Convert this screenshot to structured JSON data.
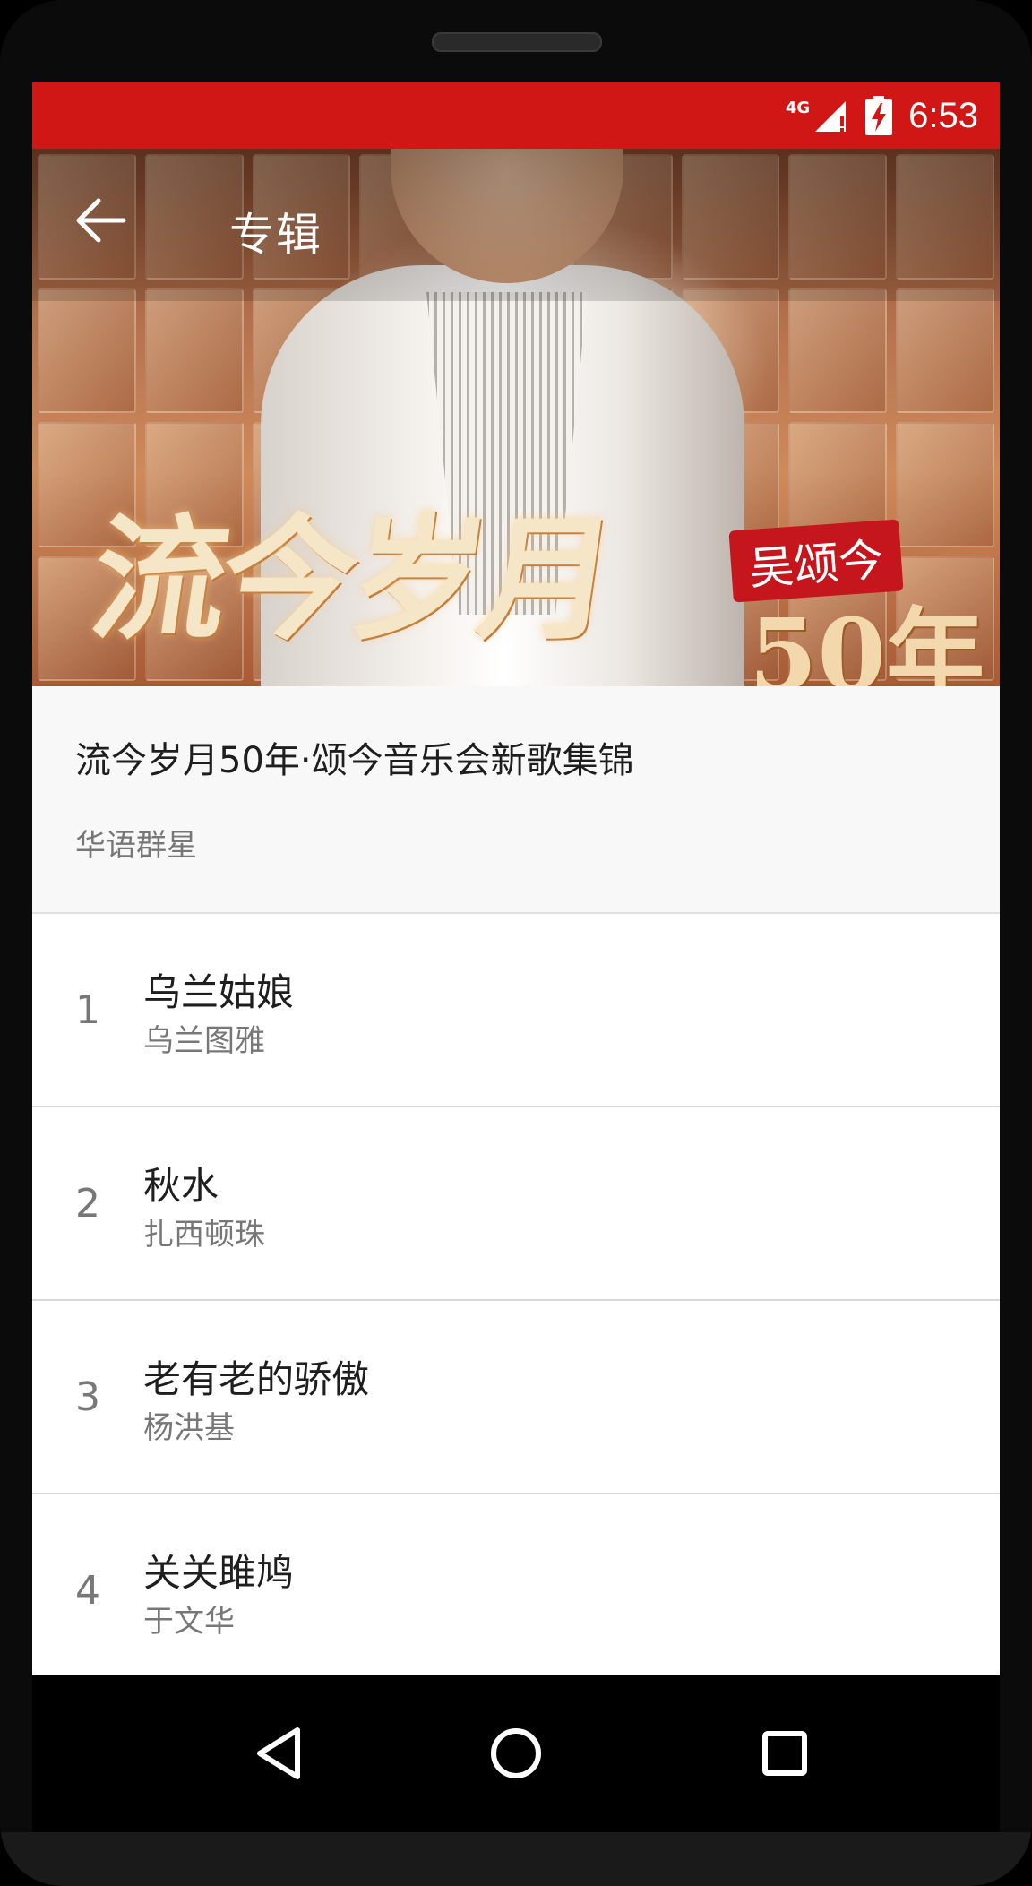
{
  "status_bar": {
    "network": "4G",
    "time": "6:53",
    "bar_color": "#d11616"
  },
  "toolbar": {
    "back_icon": "arrow-left-icon",
    "title": "专辑"
  },
  "hero": {
    "poster_title": "流今岁月",
    "poster_badge": "吴颂今",
    "poster_years": "50年"
  },
  "album": {
    "title": "流今岁月50年·颂今音乐会新歌集锦",
    "artist": "华语群星"
  },
  "tracks": [
    {
      "number": "1",
      "title": "乌兰姑娘",
      "artist": "乌兰图雅"
    },
    {
      "number": "2",
      "title": "秋水",
      "artist": "扎西顿珠"
    },
    {
      "number": "3",
      "title": "老有老的骄傲",
      "artist": "杨洪基"
    },
    {
      "number": "4",
      "title": "关关雎鸠",
      "artist": "于文华"
    }
  ],
  "nav_bar": {
    "back_icon": "triangle-back-icon",
    "home_icon": "circle-home-icon",
    "recents_icon": "square-recents-icon"
  }
}
